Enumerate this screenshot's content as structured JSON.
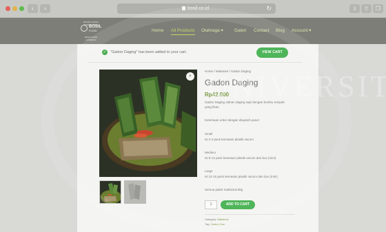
{
  "browser": {
    "url": "bosil.co.id",
    "back": "‹",
    "forward": "›",
    "reload": "↻"
  },
  "header": {
    "logo": {
      "top_line": "BADAN USAHA SUSTAINABLE",
      "name": "BOSIL",
      "sub": "FOOD",
      "bottom_line": "BOSIL FOOD CATERING"
    },
    "menu": [
      {
        "label": "Home",
        "active": false
      },
      {
        "label": "All Products",
        "active": true
      },
      {
        "label": "Olahraga ▾",
        "active": false
      },
      {
        "label": "Galeri",
        "active": false
      },
      {
        "label": "Contact",
        "active": false
      },
      {
        "label": "Blog",
        "active": false
      },
      {
        "label": "Account ▾",
        "active": false
      }
    ]
  },
  "notice": {
    "message": "\"Gadon Daging\" has been added to your cart.",
    "button": "VIEW CART"
  },
  "product": {
    "breadcrumb": "Home / Makanan / Gadon Daging",
    "title": "Gadon Daging",
    "price": "Rp42.000",
    "description_1": "Gadon Daging olahan daging sapi dengan bumbu rempah",
    "description_2": "yang khas",
    "note": "Ketentuan order dengan dispatch panel",
    "sizes": [
      {
        "name": "Small",
        "detail": "Isi 3-4 pack kemasan plastik vacum"
      },
      {
        "name": "Medium",
        "detail": "Isi 9-12 pack kemasan plastik vacum dan box (mini)"
      },
      {
        "name": "Large",
        "detail": "Isi 12-15 pack kemasan plastik vacum dan box (mini)"
      }
    ],
    "extra": "Semua paket maksimal 5kg",
    "quantity": "1",
    "add_to_cart": "ADD TO CART",
    "category_label": "Category:",
    "category_value": "Makanan",
    "tag_label": "Tag:",
    "tag_value": "Gadon Dan"
  },
  "watermark": "UNIVERSITY",
  "colors": {
    "accent_green": "#4fb55a",
    "header_bg": "#7d7e78"
  }
}
